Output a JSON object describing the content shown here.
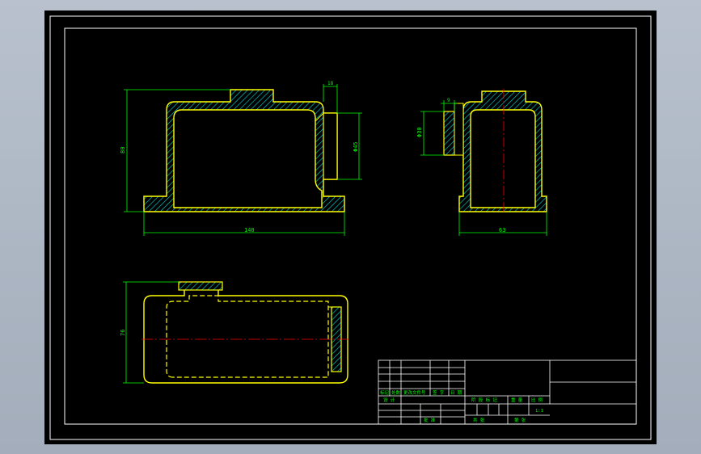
{
  "drawing": {
    "front_view": {
      "dim_width": "140",
      "dim_height": "80",
      "dim_top": "18",
      "dim_dia": "Φ45"
    },
    "side_view": {
      "dim_width": "63",
      "dim_small": "9",
      "dim_dia": "Φ30"
    },
    "plan_view": {
      "dim_height": "76"
    },
    "title_block": {
      "c1": "标记",
      "c2": "处数",
      "c3": "更改文件号",
      "c4": "签 字",
      "c5": "日 期",
      "designer": "设 计",
      "stage": "阶 段 标 记",
      "weight": "重 量",
      "ratio_label": "比 例",
      "scale": "1:1",
      "approve": "批 准",
      "sheet_total": "共   张",
      "sheet_no": "第   张"
    }
  },
  "colors": {
    "background": "#000000",
    "frame": "#ffffff",
    "outline": "#ffff00",
    "hatch": "#00cccc",
    "dimension": "#00ff00",
    "centerline": "#ff0000"
  }
}
